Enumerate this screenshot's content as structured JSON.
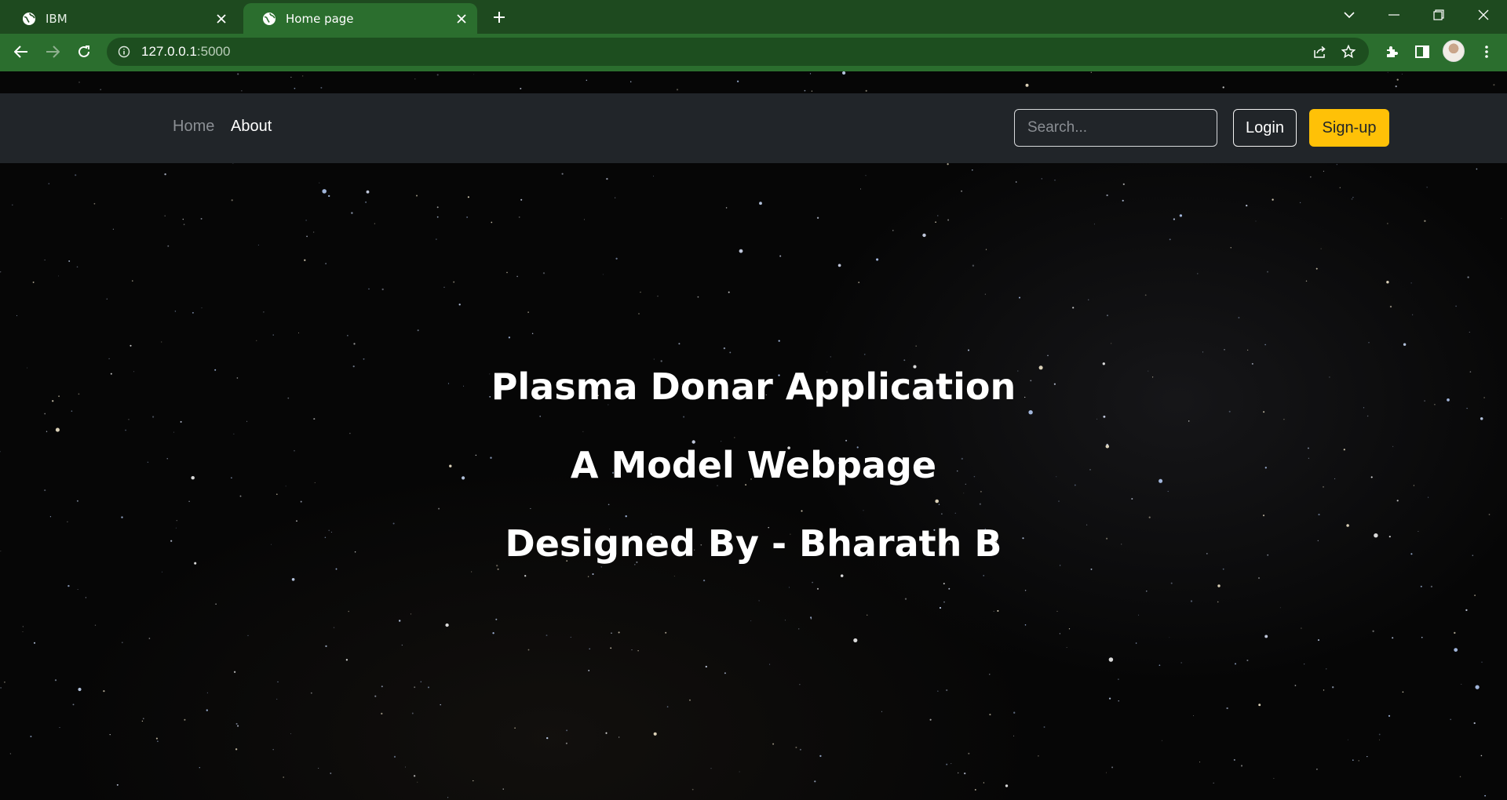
{
  "browser": {
    "tabs": [
      {
        "title": "IBM",
        "active": false
      },
      {
        "title": "Home page",
        "active": true
      }
    ],
    "address": {
      "host": "127.0.0.1",
      "port": ":5000"
    },
    "colors": {
      "tabstrip": "#1e4a1f",
      "toolbar": "#2b6e2e",
      "omnibox": "#1d4e1f"
    }
  },
  "navbar": {
    "links": [
      {
        "label": "Home"
      },
      {
        "label": "About"
      }
    ],
    "search": {
      "placeholder": "Search...",
      "value": ""
    },
    "login_label": "Login",
    "signup_label": "Sign-up",
    "colors": {
      "background": "#212529",
      "signup": "#ffc107"
    }
  },
  "hero": {
    "line1": "Plasma Donar Application",
    "line2": "A Model Webpage",
    "line3": "Designed By - Bharath B"
  }
}
